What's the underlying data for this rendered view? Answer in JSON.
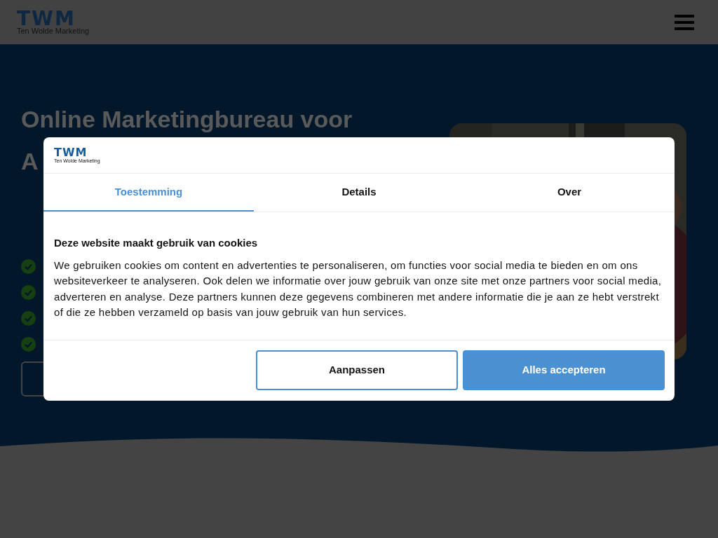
{
  "header": {
    "logo_mark": "TWM",
    "logo_name": "Ten Wolde Marketing"
  },
  "hero": {
    "heading_lines": [
      "Online Marketingbureau voor",
      "A"
    ]
  },
  "cookie_dialog": {
    "logo_mark": "TWM",
    "logo_name": "Ten Wolde Marketing",
    "tabs": [
      {
        "label": "Toestemming",
        "selected": true
      },
      {
        "label": "Details",
        "selected": false
      },
      {
        "label": "Over",
        "selected": false
      }
    ],
    "title": "Deze website maakt gebruik van cookies",
    "body": "We gebruiken cookies om content en advertenties te personaliseren, om functies voor social media te bieden en om ons websiteverkeer te analyseren. Ook delen we informatie over jouw gebruik van onze site met onze partners voor social media, adverteren en analyse. Deze partners kunnen deze gegevens combineren met andere informatie die je aan ze hebt verstrekt of die ze hebben verzameld op basis van jouw gebruik van hun services.",
    "buttons": [
      {
        "label": "Aanpassen",
        "kind": "outline"
      },
      {
        "label": "Alles accepteren",
        "kind": "primary"
      }
    ]
  }
}
